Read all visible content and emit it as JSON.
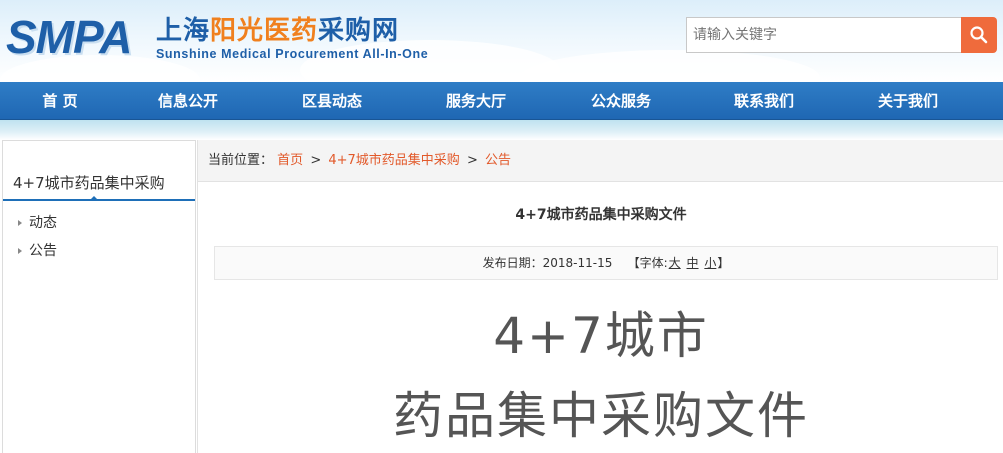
{
  "header": {
    "logo_mark": "SMPA",
    "logo_cn_prefix": "上海",
    "logo_cn_highlight": "阳光医药",
    "logo_cn_suffix": "采购网",
    "logo_en": "Sunshine Medical Procurement All-In-One",
    "search_placeholder": "请输入关键字"
  },
  "nav": {
    "items": [
      "首 页",
      "信息公开",
      "区县动态",
      "服务大厅",
      "公众服务",
      "联系我们",
      "关于我们"
    ]
  },
  "sidebar": {
    "title": "4+7城市药品集中采购",
    "items": [
      "动态",
      "公告"
    ]
  },
  "breadcrumb": {
    "label": "当前位置：",
    "links": [
      "首页",
      "4+7城市药品集中采购",
      "公告"
    ],
    "separator": ">"
  },
  "article": {
    "title": "4+7城市药品集中采购文件",
    "date_label": "发布日期：",
    "date": "2018-11-15",
    "font_label": "【字体:",
    "font_sizes": [
      "大",
      "中",
      "小"
    ],
    "font_close": "】",
    "body_line1": "4+7城市",
    "body_line2": "药品集中采购文件"
  },
  "colors": {
    "nav_bg": "#2370bb",
    "accent_link": "#e2592a",
    "search_button": "#ef6b3c",
    "logo_blue": "#1e5fa8",
    "logo_orange": "#f0801e"
  }
}
